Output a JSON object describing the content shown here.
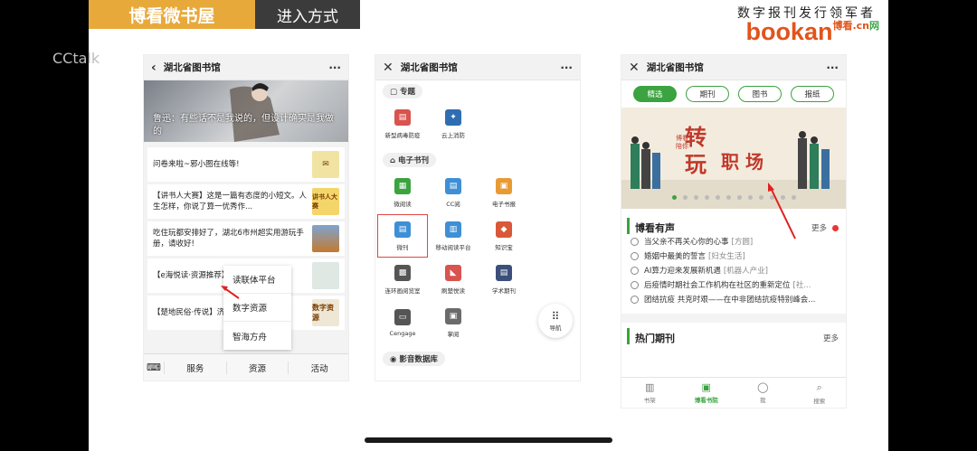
{
  "header": {
    "tab_title": "博看微书屋",
    "tab_method": "进入方式",
    "slogan": "数字报刊发行领军者",
    "logo": "bookan",
    "logo_cn": "博看",
    "logo_tld": ".cn",
    "logo_tld_net": "网"
  },
  "watermark": "CCtalk",
  "phone1": {
    "title": "湖北省图书馆",
    "back": "‹",
    "more": "···",
    "banner_quote": "鲁迅：有些话不是我说的，但设计确实是我做的",
    "articles": [
      {
        "text": "问卷来啦~邪小图在线等!",
        "thumb": "✉",
        "thumb_color": "#f1e4a3"
      },
      {
        "text": "【讲书人大赛】这是一篇有态度的小短文。人生怎样，你说了算一优秀作...",
        "thumb": "讲书人大赛",
        "thumb_color": "#f4d56a"
      },
      {
        "text": "吃住玩都安排好了，湖北6市州超实用游玩手册，请收好!",
        "thumb": "",
        "thumb_color": "#6d8fb8"
      },
      {
        "text": "【e海悦读·资源推荐】识为舟、乘风破浪",
        "thumb": "",
        "thumb_color": "#dfe8e3"
      },
      {
        "text": "【楚地民俗·传说】济灾民能有多好?",
        "thumb": "数字资源",
        "thumb_color": "#efe7d6"
      }
    ],
    "popup": [
      "读联体平台",
      "数字资源",
      "智海方舟"
    ],
    "menu": {
      "keyboard": "⌨",
      "items": [
        "服务",
        "资源",
        "活动"
      ]
    }
  },
  "phone2": {
    "title": "湖北省图书馆",
    "close": "✕",
    "more": "···",
    "sec_topic": "专题",
    "topic_items": [
      {
        "label": "新型病毒防疫",
        "icon": "▤",
        "color": "#d9534f"
      },
      {
        "label": "云上消防",
        "icon": "✦",
        "color": "#2f6db3"
      }
    ],
    "sec_ebook": "电子书刊",
    "ebook_items": [
      {
        "label": "微阅读",
        "icon": "▦",
        "color": "#3ba33f"
      },
      {
        "label": "CC阅",
        "icon": "▤",
        "color": "#3e8fd6"
      },
      {
        "label": "电子书报",
        "icon": "▣",
        "color": "#e89a35"
      },
      {
        "label": "微刊",
        "icon": "▤",
        "color": "#3e8fd6"
      },
      {
        "label": "移动阅读平台",
        "icon": "▥",
        "color": "#3e8fd6"
      },
      {
        "label": "知识宝",
        "icon": "◆",
        "color": "#d9583a"
      },
      {
        "label": "连环画阅览室",
        "icon": "▩",
        "color": "#555"
      },
      {
        "label": "刷楚悦读",
        "icon": "◣",
        "color": "#d9534f"
      },
      {
        "label": "学术期刊",
        "icon": "▤",
        "color": "#3b4f7a"
      },
      {
        "label": "Cengage",
        "icon": "▭",
        "color": "#555"
      },
      {
        "label": "掌阅",
        "icon": "▣",
        "color": "#6b6b6b"
      }
    ],
    "sec_media": "影音数据库",
    "nav_fab": "导航"
  },
  "phone3": {
    "title": "湖北省图书馆",
    "close": "✕",
    "more": "···",
    "pills": [
      "精选",
      "期刊",
      "图书",
      "报纸"
    ],
    "banner_a": "博看 陪你",
    "banner_b": "转",
    "banner_c": "玩",
    "banner_d": "职场",
    "sec_audio": "博看有声",
    "more_label": "更多",
    "audio": [
      {
        "title": "当父亲不再关心你的心事",
        "tag": "[方圆]"
      },
      {
        "title": "婚姻中最美的誓言",
        "tag": "[妇女生活]"
      },
      {
        "title": "AI算力迎来发展新机遇",
        "tag": "[机器人产业]"
      },
      {
        "title": "后疫情时期社会工作机构在社区的重新定位",
        "tag": "[社..."
      },
      {
        "title": "团结抗疫 共克时艰——在中非团结抗疫特别峰会...",
        "tag": ""
      }
    ],
    "sec_hot": "热门期刊",
    "tabbar": [
      {
        "label": "书架",
        "icon": "▥"
      },
      {
        "label": "博看书院",
        "icon": "▣"
      },
      {
        "label": "我",
        "icon": "◯"
      },
      {
        "label": "搜索",
        "icon": "⌕"
      }
    ]
  }
}
